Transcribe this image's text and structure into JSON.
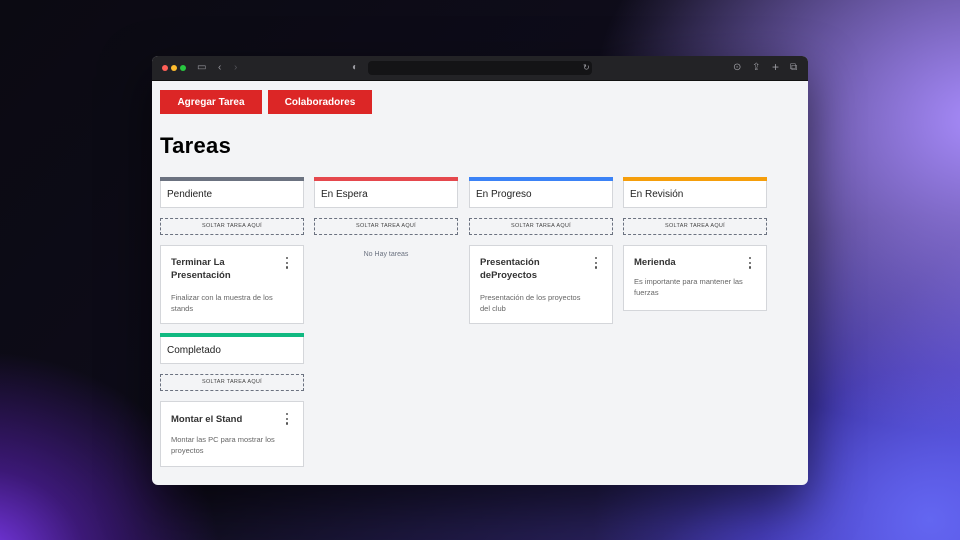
{
  "toolbar": {
    "add_task_label": "Agregar Tarea",
    "collaborators_label": "Colaboradores"
  },
  "page_title": "Tareas",
  "colors": {
    "accent": "#dc2626",
    "pendiente": "#6b7280",
    "en_espera": "#e5484d",
    "en_progreso": "#3b82f6",
    "en_revision": "#f59e0b",
    "completado": "#10b981"
  },
  "dropzone_label": "SOLTAR TAREA AQUÍ",
  "columns": [
    {
      "title": "Pendiente",
      "cards": [
        {
          "title": "Terminar La Presentación",
          "description": "Finalizar con la muestra de los stands"
        }
      ]
    },
    {
      "title": "En Espera",
      "empty_text": "No Hay tareas"
    },
    {
      "title": "En Progreso",
      "cards": [
        {
          "title": "Presentación deProyectos",
          "description": "Presentación de los proyectos del club"
        }
      ]
    },
    {
      "title": "En Revisión",
      "cards": [
        {
          "title": "Merienda",
          "description": "Es importante para mantener las fuerzas"
        }
      ]
    },
    {
      "title": "Completado",
      "cards": [
        {
          "title": "Montar el Stand",
          "description": "Montar las PC para mostrar los proyectos"
        }
      ]
    }
  ]
}
